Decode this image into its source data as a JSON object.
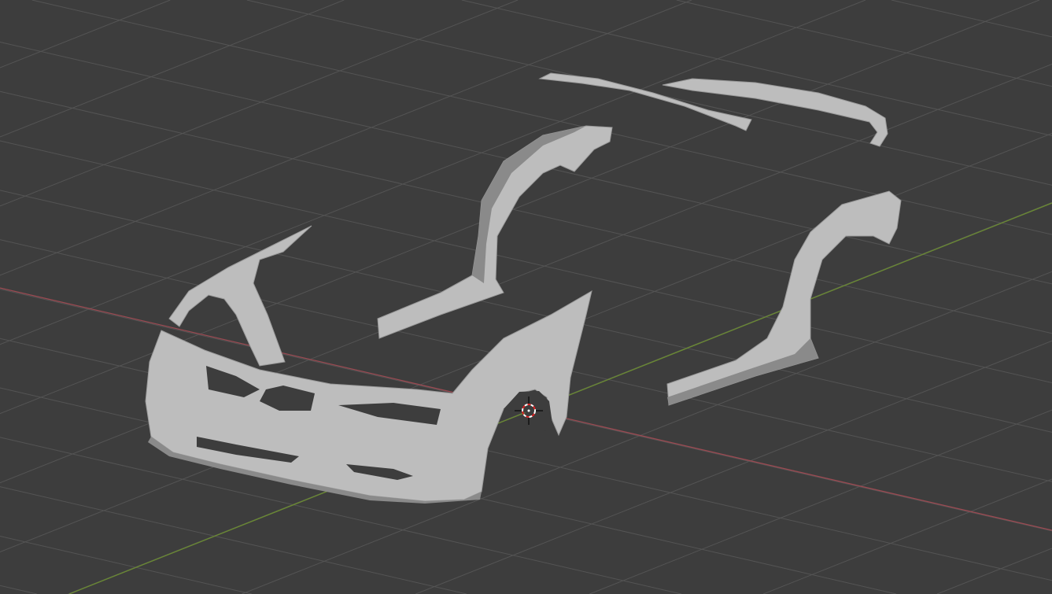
{
  "viewport": {
    "background": "#3d3d3d",
    "grid_color": "#545454",
    "x_axis_color": "#9a4a52",
    "y_axis_color": "#6a8a32",
    "mesh_color": "#bdbdbd",
    "mesh_shadow": "#8a8a8a"
  },
  "icons": {
    "cursor": "3d-cursor-icon"
  }
}
